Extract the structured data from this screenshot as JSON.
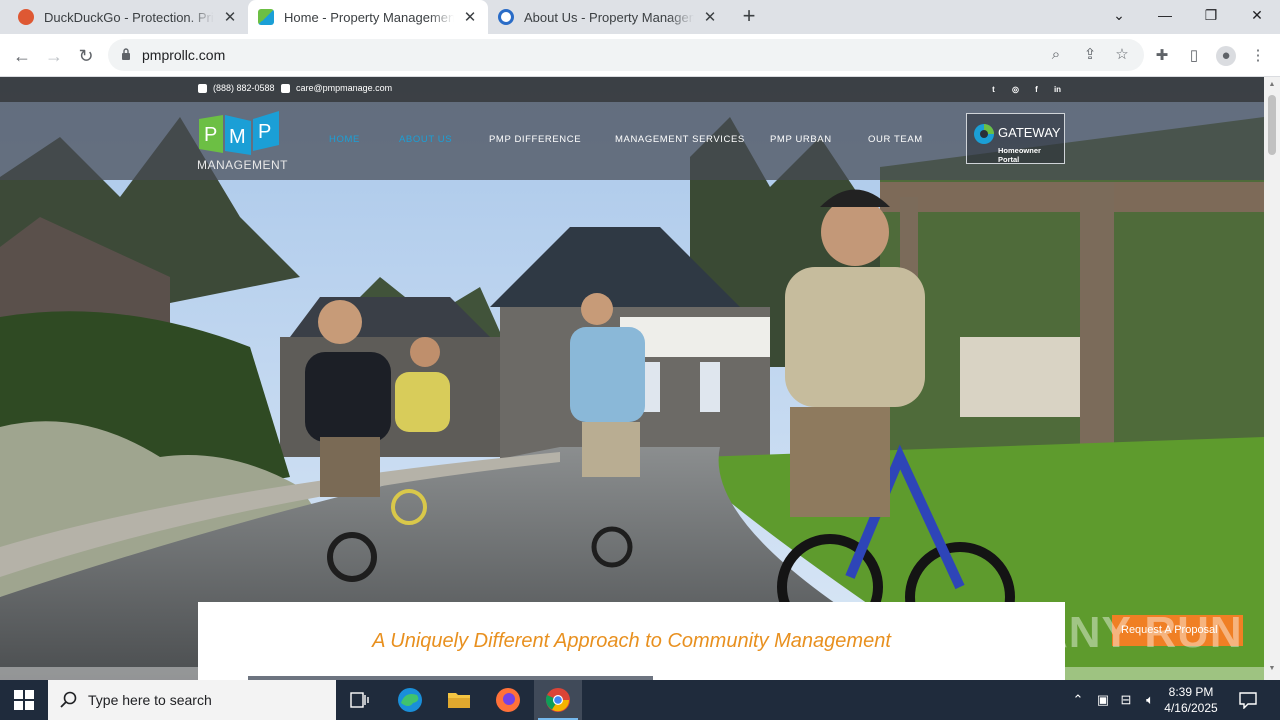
{
  "browser": {
    "tabs": [
      {
        "title": "DuckDuckGo - Protection. Privacy. Peace of mind.",
        "active": false
      },
      {
        "title": "Home - Property Management PMP",
        "active": true
      },
      {
        "title": "About Us - Property Management PMP",
        "active": false
      }
    ],
    "new_tab_label": "+",
    "url": "pmprollc.com"
  },
  "site": {
    "phone": "(888) 882-0588",
    "email": "care@pmpmanage.com",
    "social": [
      "twitter-icon",
      "instagram-icon",
      "facebook-icon",
      "linkedin-icon"
    ],
    "logo_text": "MANAGEMENT",
    "logo_letters": [
      "P",
      "M",
      "P"
    ],
    "nav": [
      {
        "label": "HOME",
        "current": true
      },
      {
        "label": "ABOUT US",
        "current": true
      },
      {
        "label": "PMP DIFFERENCE",
        "current": false
      },
      {
        "label": "MANAGEMENT SERVICES",
        "current": false
      },
      {
        "label": "PMP URBAN",
        "current": false
      },
      {
        "label": "OUR TEAM",
        "current": false
      }
    ],
    "gateway_title": "GATEWAY",
    "gateway_subtitle": "Homeowner Portal",
    "headline": "A Uniquely Different Approach to Community Management",
    "proposal_button": "Request A Proposal",
    "watermark": "ANY RUN"
  },
  "taskbar": {
    "search_placeholder": "Type here to search",
    "time": "8:39 PM",
    "date": "4/16/2025"
  },
  "colors": {
    "nav_current": "#1b9fd6",
    "headline": "#e8901f",
    "proposal": "#f07f24",
    "taskbar": "#1f2b3c"
  }
}
